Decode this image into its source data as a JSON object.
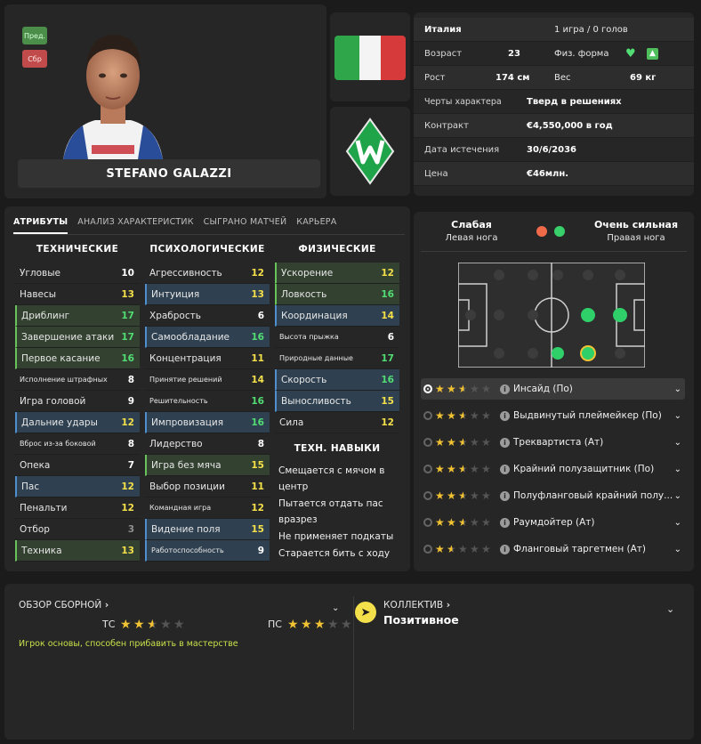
{
  "player": {
    "name": "STEFANO GALAZZI",
    "badge_warn": "Пред.",
    "badge_team": "Сбр"
  },
  "info": {
    "nation": "Италия",
    "caps": "1 игра / 0 голов",
    "age_label": "Возраст",
    "age": "23",
    "fitness_label": "Физ. форма",
    "height_label": "Рост",
    "height": "174 см",
    "weight_label": "Вес",
    "weight": "69 кг",
    "trait_label": "Черты характера",
    "trait": "Тверд в решениях",
    "contract_label": "Контракт",
    "contract": "€4,550,000 в год",
    "expiry_label": "Дата истечения",
    "expiry": "30/6/2036",
    "value_label": "Цена",
    "value": "€46млн."
  },
  "tabs": [
    "АТРИБУТЫ",
    "АНАЛИЗ ХАРАКТЕРИСТИК",
    "СЫГРАНО МАТЧЕЙ",
    "КАРЬЕРА"
  ],
  "attributes": {
    "technical_title": "ТЕХНИЧЕСКИЕ",
    "mental_title": "ПСИХОЛОГИЧЕСКИЕ",
    "physical_title": "ФИЗИЧЕСКИЕ",
    "technical": [
      {
        "name": "Угловые",
        "value": "10",
        "hl": "",
        "color": "wht"
      },
      {
        "name": "Навесы",
        "value": "13",
        "hl": "",
        "color": "yel"
      },
      {
        "name": "Дриблинг",
        "value": "17",
        "hl": "g",
        "color": "grn"
      },
      {
        "name": "Завершение атаки",
        "value": "17",
        "hl": "g",
        "color": "grn"
      },
      {
        "name": "Первое касание",
        "value": "16",
        "hl": "g",
        "color": "grn"
      },
      {
        "name": "Исполнение штрафных",
        "value": "8",
        "hl": "",
        "color": "wht",
        "sm": true
      },
      {
        "name": "Игра головой",
        "value": "9",
        "hl": "",
        "color": "wht"
      },
      {
        "name": "Дальние удары",
        "value": "12",
        "hl": "b",
        "color": "yel"
      },
      {
        "name": "Вброс из-за боковой",
        "value": "8",
        "hl": "",
        "color": "wht",
        "sm": true
      },
      {
        "name": "Опека",
        "value": "7",
        "hl": "",
        "color": "wht"
      },
      {
        "name": "Пас",
        "value": "12",
        "hl": "b",
        "color": "yel"
      },
      {
        "name": "Пенальти",
        "value": "12",
        "hl": "",
        "color": "yel"
      },
      {
        "name": "Отбор",
        "value": "3",
        "hl": "",
        "color": "gray"
      },
      {
        "name": "Техника",
        "value": "13",
        "hl": "g",
        "color": "yel"
      }
    ],
    "mental": [
      {
        "name": "Агрессивность",
        "value": "12",
        "hl": "",
        "color": "yel"
      },
      {
        "name": "Интуиция",
        "value": "13",
        "hl": "b",
        "color": "yel"
      },
      {
        "name": "Храбрость",
        "value": "6",
        "hl": "",
        "color": "wht"
      },
      {
        "name": "Самообладание",
        "value": "16",
        "hl": "b",
        "color": "grn"
      },
      {
        "name": "Концентрация",
        "value": "11",
        "hl": "",
        "color": "yel"
      },
      {
        "name": "Принятие решений",
        "value": "14",
        "hl": "",
        "color": "yel",
        "sm": true
      },
      {
        "name": "Решительность",
        "value": "16",
        "hl": "",
        "color": "grn",
        "sm": true
      },
      {
        "name": "Импровизация",
        "value": "16",
        "hl": "b",
        "color": "grn"
      },
      {
        "name": "Лидерство",
        "value": "8",
        "hl": "",
        "color": "wht"
      },
      {
        "name": "Игра без мяча",
        "value": "15",
        "hl": "g",
        "color": "yel"
      },
      {
        "name": "Выбор позиции",
        "value": "11",
        "hl": "",
        "color": "yel"
      },
      {
        "name": "Командная игра",
        "value": "12",
        "hl": "",
        "color": "yel",
        "sm": true
      },
      {
        "name": "Видение поля",
        "value": "15",
        "hl": "b",
        "color": "yel"
      },
      {
        "name": "Работоспособность",
        "value": "9",
        "hl": "b",
        "color": "wht",
        "sm": true
      }
    ],
    "physical": [
      {
        "name": "Ускорение",
        "value": "12",
        "hl": "g",
        "color": "yel"
      },
      {
        "name": "Ловкость",
        "value": "16",
        "hl": "g",
        "color": "grn"
      },
      {
        "name": "Координация",
        "value": "14",
        "hl": "b",
        "color": "yel"
      },
      {
        "name": "Высота прыжка",
        "value": "6",
        "hl": "",
        "color": "wht",
        "sm": true
      },
      {
        "name": "Природные данные",
        "value": "17",
        "hl": "",
        "color": "grn",
        "sm": true
      },
      {
        "name": "Скорость",
        "value": "16",
        "hl": "b",
        "color": "grn"
      },
      {
        "name": "Выносливость",
        "value": "15",
        "hl": "b",
        "color": "yel"
      },
      {
        "name": "Сила",
        "value": "12",
        "hl": "",
        "color": "yel"
      }
    ],
    "skills_title": "ТЕХН. НАВЫКИ",
    "traits": [
      "Смещается с мячом в центр",
      "Пытается отдать пас вразрез",
      "Не применяет подкаты",
      "Старается бить с ходу"
    ]
  },
  "feet": {
    "weak_label": "Слабая",
    "weak_sub": "Левая нога",
    "strong_label": "Очень сильная",
    "strong_sub": "Правая нога"
  },
  "roles": [
    {
      "name": "Инсайд (По)",
      "stars": 2.5,
      "selected": true
    },
    {
      "name": "Выдвинутый плеймейкер (По)",
      "stars": 2.5,
      "selected": false
    },
    {
      "name": "Треквартиста (Ат)",
      "stars": 2.5,
      "selected": false
    },
    {
      "name": "Крайний полузащитник (По)",
      "stars": 2.5,
      "selected": false
    },
    {
      "name": "Полуфланговый крайний полу...",
      "stars": 2.5,
      "selected": false
    },
    {
      "name": "Раумдойтер (Ат)",
      "stars": 2.5,
      "selected": false
    },
    {
      "name": "Фланговый таргетмен (Ат)",
      "stars": 1.5,
      "selected": false
    }
  ],
  "bottom": {
    "national_title": "ОБЗОР СБОРНОЙ",
    "tc_label": "ТС",
    "tc_stars": 2.5,
    "pc_label": "ПС",
    "pc_stars": 3,
    "national_note": "Игрок основы, способен прибавить в мастерстве",
    "team_title": "КОЛЛЕКТИВ",
    "team_value": "Позитивное"
  },
  "colors": {
    "green": "#52dd74",
    "yellow": "#f3e04a",
    "star": "#f1c232"
  }
}
